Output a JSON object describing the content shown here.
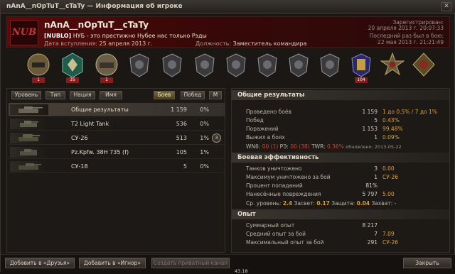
{
  "window": {
    "title": "nAnA__nOpTuT__cTaTy — Информация об игроке"
  },
  "player": {
    "clan_tag_logo": "NUB",
    "name": "nAnA__nOpTuT__cTaTy",
    "clan_tag": "[NUBLO]",
    "clan_motto": "НУБ - это престижно Нубее нас только Рэды",
    "join_label": "Дата вступления:",
    "join_date": "25 апреля 2013 г.",
    "role_label": "Должность:",
    "role": "Заместитель командира",
    "registered_label": "Зарегистрирован:",
    "registered": "20 апреля 2013 г. 20:07:33",
    "last_battle_label": "Последний раз был в бою:",
    "last_battle": "22 мая 2013 г. 21:21:49"
  },
  "medals": [
    {
      "icon": "tank-expert-icon",
      "count": "1"
    },
    {
      "icon": "medal-green-icon",
      "count": "35"
    },
    {
      "icon": "tank-medal-icon",
      "count": "1"
    },
    {
      "icon": "shield-medal-icon",
      "count": ""
    },
    {
      "icon": "shield-medal-icon",
      "count": ""
    },
    {
      "icon": "shield-medal-icon",
      "count": ""
    },
    {
      "icon": "shield-medal-icon",
      "count": ""
    },
    {
      "icon": "shield-medal-icon",
      "count": ""
    },
    {
      "icon": "shield-medal-icon",
      "count": ""
    },
    {
      "icon": "shield-medal-icon",
      "count": ""
    },
    {
      "icon": "medal-blue-icon",
      "count": "104"
    },
    {
      "icon": "star-medal-icon",
      "count": ""
    },
    {
      "icon": "order-medal-icon",
      "count": ""
    }
  ],
  "filters": {
    "level": "Уровень",
    "type": "Тип",
    "nation": "Нация",
    "name": "Имя",
    "battles": "Боев",
    "wins": "Побед",
    "m": "М"
  },
  "vehicles": [
    {
      "name": "Общие результаты",
      "battles": "1 159",
      "pct": "0%",
      "ace": ""
    },
    {
      "name": "T2 Light Tank",
      "battles": "536",
      "pct": "0%",
      "ace": ""
    },
    {
      "name": "СУ-26",
      "battles": "513",
      "pct": "1%",
      "ace": "3"
    },
    {
      "name": "Pz.Kpfw. 38H 735 (f)",
      "battles": "105",
      "pct": "1%",
      "ace": ""
    },
    {
      "name": "СУ-18",
      "battles": "5",
      "pct": "0%",
      "ace": ""
    }
  ],
  "overall": {
    "title": "Общие результаты",
    "rows": [
      {
        "label": "Проведено боёв",
        "value": "1 159",
        "extra": "1 до 0.5% / 7 до 1%"
      },
      {
        "label": "Побед",
        "value": "5",
        "extra": "0.43%"
      },
      {
        "label": "Поражений",
        "value": "1 153",
        "extra": "99.48%"
      },
      {
        "label": "Выжил в боях",
        "value": "1",
        "extra": "0.09%"
      }
    ],
    "wn6_label": "WN6:",
    "wn6_a": "00",
    "wn6_b": "(1)",
    "re_label": "РЭ:",
    "re_a": "00",
    "re_b": "(38)",
    "twr_label": "TWR:",
    "twr": "0.36%",
    "updated": "обновлено: 2013-05-22"
  },
  "efficiency": {
    "title": "Боевая эффективность",
    "rows": [
      {
        "label": "Танков уничтожено",
        "value": "3",
        "extra": "0.00"
      },
      {
        "label": "Максимум уничтожено за бой",
        "value": "1",
        "extra": "СУ-26"
      },
      {
        "label": "Процент попаданий",
        "value": "81%",
        "extra": ""
      },
      {
        "label": "Нанесённые повреждения",
        "value": "5 797",
        "extra": "5.00"
      }
    ],
    "avg_level_label": "Ср. уровень:",
    "avg_level": "2.4",
    "spot_label": "Засвет:",
    "spot": "0.17",
    "def_label": "Защита:",
    "def": "0.04",
    "cap_label": "Захват:",
    "cap": "-"
  },
  "experience": {
    "title": "Опыт",
    "rows": [
      {
        "label": "Суммарный опыт",
        "value": "8 217",
        "extra": ""
      },
      {
        "label": "Средний опыт за бой",
        "value": "7",
        "extra": "7.09"
      },
      {
        "label": "Максимальный опыт за бой",
        "value": "291",
        "extra": "СУ-26"
      }
    ]
  },
  "footer": {
    "add_friends": "Добавить в «Друзья»",
    "add_ignore": "Добавить в «Игнор»",
    "create_channel": "Создать приватный канал",
    "close": "Закрыть"
  },
  "hp_text": "43.18"
}
